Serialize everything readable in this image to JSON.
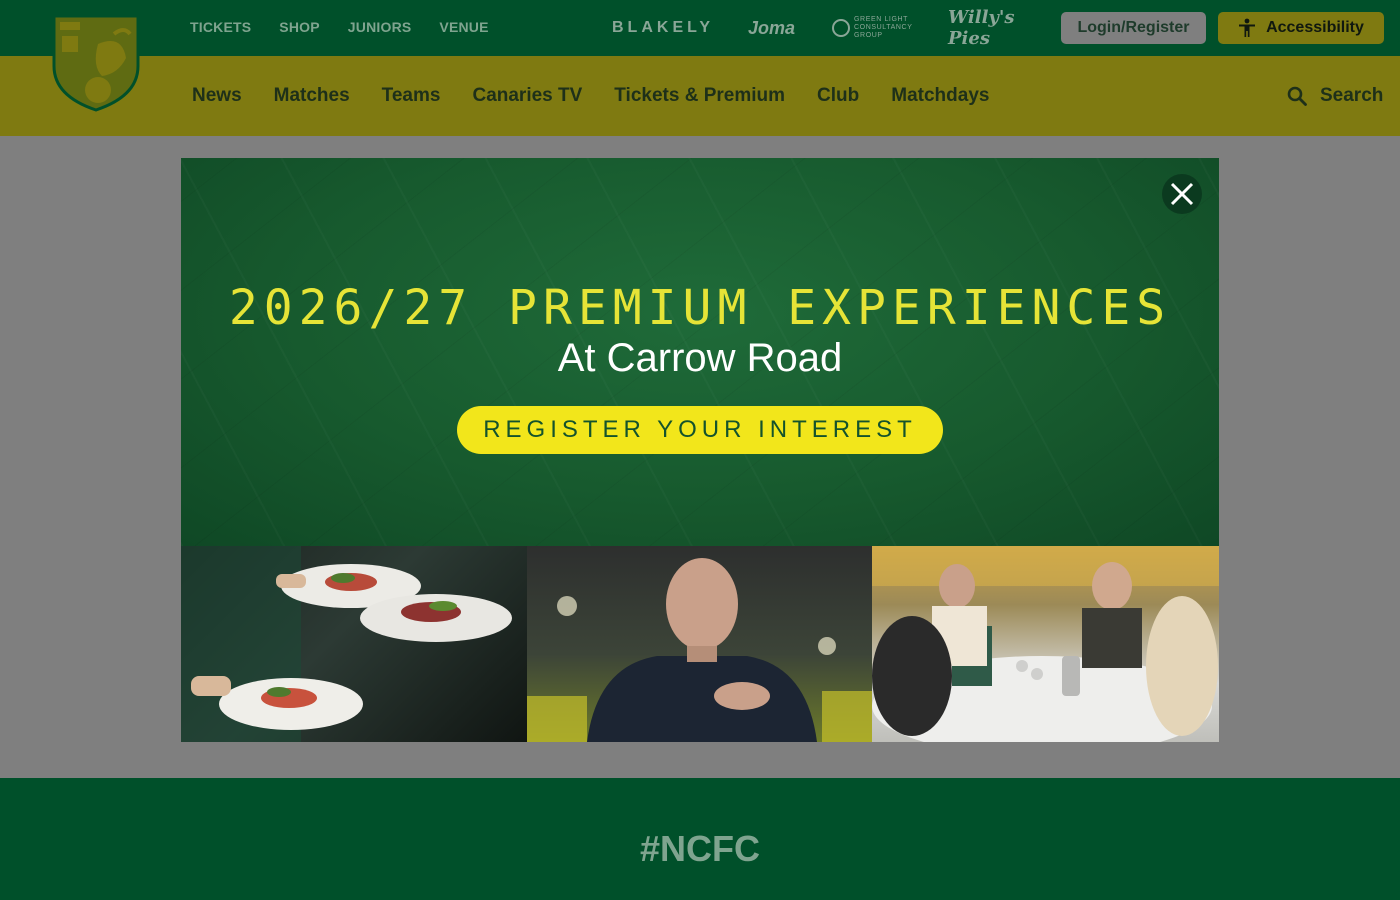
{
  "header": {
    "utility_links": [
      "TICKETS",
      "SHOP",
      "JUNIORS",
      "VENUE"
    ],
    "sponsors": {
      "blakely": "BLAKELY",
      "joma": "Joma",
      "green_light": [
        "GREEN LIGHT",
        "CONSULTANCY GROUP"
      ],
      "willys": "Willy's Pies"
    },
    "login_label": "Login/Register",
    "accessibility_label": "Accessibility"
  },
  "nav": {
    "items": [
      "News",
      "Matches",
      "Teams",
      "Canaries TV",
      "Tickets & Premium",
      "Club",
      "Matchdays"
    ],
    "search_label": "Search"
  },
  "modal": {
    "title": "2026/27 PREMIUM EXPERIENCES",
    "subtitle": "At Carrow Road",
    "cta_label": "REGISTER YOUR INTEREST",
    "photos": [
      "plated-dishes-photo",
      "smiling-man-photo",
      "hospitality-dining-photo"
    ]
  },
  "footer": {
    "hashtag": "#NCFC"
  },
  "colors": {
    "header_green": "#00502a",
    "nav_yellow_dimmed": "#7f7a11",
    "promo_yellow": "#f2e61b",
    "overlay_grey": "#7f7f7f"
  }
}
